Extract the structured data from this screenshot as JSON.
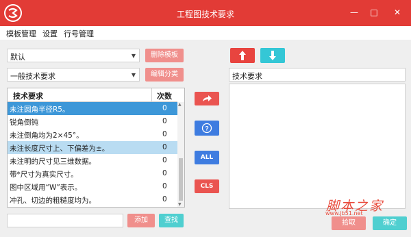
{
  "window": {
    "title": "工程图技术要求",
    "minimize": "—",
    "maximize": "□",
    "close": "✕"
  },
  "menu": [
    "模板管理",
    "设置",
    "行号管理"
  ],
  "template_select": {
    "value": "默认"
  },
  "delete_template_button": "删除模板",
  "category_select": {
    "value": "一般技术要求"
  },
  "edit_category_button": "编辑分类",
  "table": {
    "headers": [
      "技术要求",
      "次数"
    ],
    "rows": [
      {
        "text": "未注圆角半径R5。",
        "count": "0",
        "state": "selected"
      },
      {
        "text": "锐角倒钝",
        "count": "0",
        "state": "normal"
      },
      {
        "text": "未注倒角均为2×45°。",
        "count": "0",
        "state": "normal"
      },
      {
        "text": "未注长度尺寸上、下偏差为±。",
        "count": "0",
        "state": "highlight"
      },
      {
        "text": "未注明的尺寸见三维数据。",
        "count": "0",
        "state": "normal"
      },
      {
        "text": "带*尺寸为真实尺寸。",
        "count": "0",
        "state": "normal"
      },
      {
        "text": "图中区域用“W”表示。",
        "count": "0",
        "state": "normal"
      },
      {
        "text": "冲孔、切边的粗糙度均为。",
        "count": "0",
        "state": "normal"
      }
    ]
  },
  "search_input": {
    "value": ""
  },
  "add_button": "添加",
  "find_button": "查找",
  "middle_buttons": {
    "all": "ALL",
    "cls": "CLS"
  },
  "right_title_input": {
    "value": "技术要求"
  },
  "pick_button": "拾取",
  "ok_button": "确定",
  "watermark": {
    "text": "脚本之家",
    "url": "www.jb51.net"
  },
  "colors": {
    "title_bar": "#e23b36",
    "selected_row": "#3d97d8",
    "highlight_row": "#b9dcf2",
    "red_button": "#f08f8c",
    "teal_button": "#4fcfd0",
    "blue_button": "#3e7ce0"
  }
}
